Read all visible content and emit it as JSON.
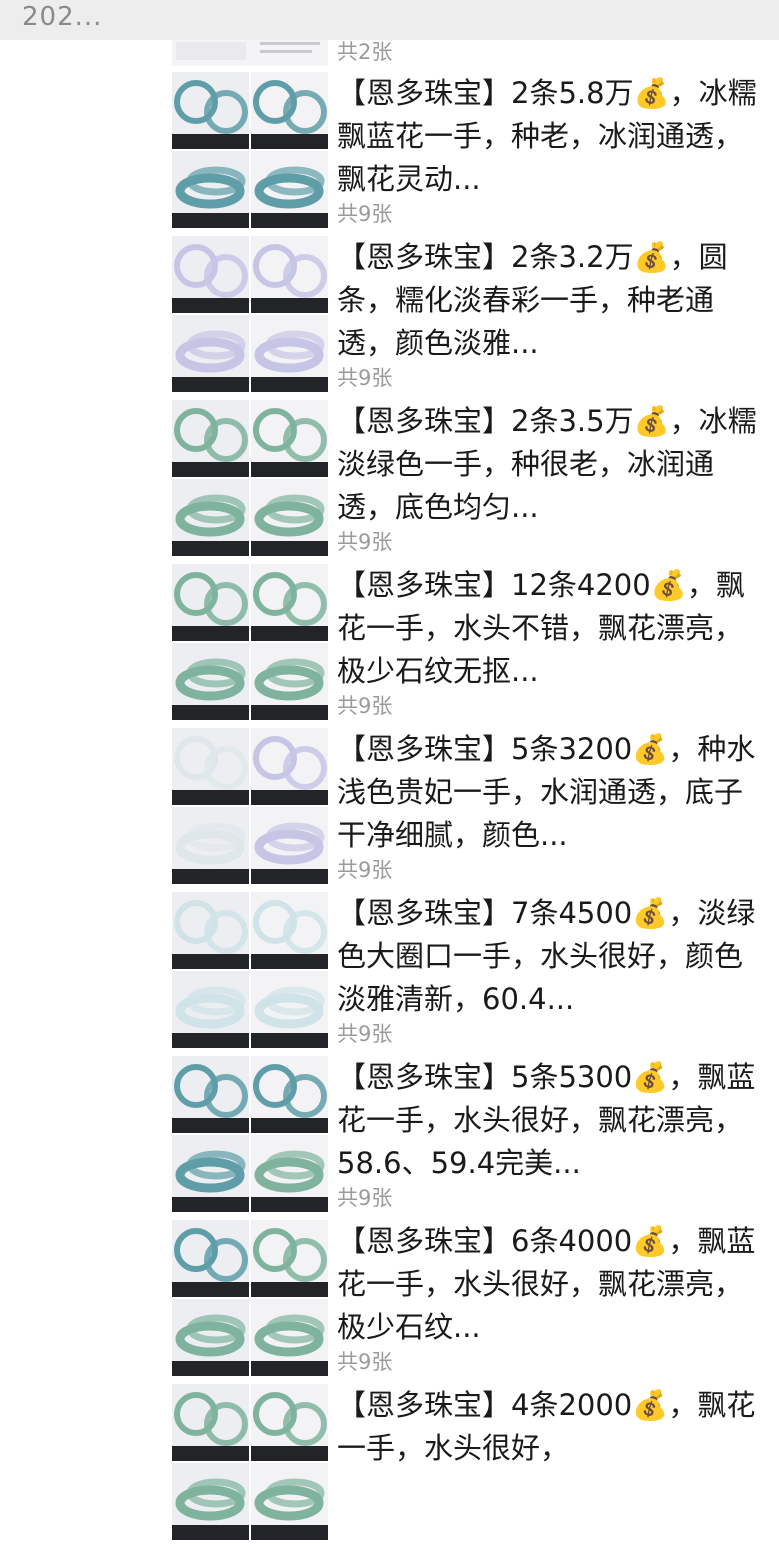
{
  "header": {
    "date": "202..."
  },
  "colors": {
    "jade_blue": "#5f9ea8",
    "jade_green": "#7fb39e",
    "lavender": "#c7c5e6",
    "white_jade": "#dfe7ea",
    "ice": "#cfe3e8"
  },
  "first_post": {
    "count": "共2张"
  },
  "posts": [
    {
      "caption": "【恩多珠宝】2条5.8万💰，冰糯飘蓝花一手，种老，冰润通透，飘花灵动...",
      "count": "共9张",
      "style": [
        "jade_blue",
        "jade_blue",
        "jade_blue",
        "jade_blue"
      ]
    },
    {
      "caption": "【恩多珠宝】2条3.2万💰，圆条，糯化淡春彩一手，种老通透，颜色淡雅...",
      "count": "共9张",
      "style": [
        "lavender",
        "lavender",
        "lavender",
        "lavender"
      ]
    },
    {
      "caption": "【恩多珠宝】2条3.5万💰，冰糯淡绿色一手，种很老，冰润通透，底色均匀...",
      "count": "共9张",
      "style": [
        "jade_green",
        "jade_green",
        "jade_green",
        "jade_green"
      ]
    },
    {
      "caption": "【恩多珠宝】12条4200💰，飘花一手，水头不错，飘花漂亮，极少石纹无抠...",
      "count": "共9张",
      "style": [
        "jade_green",
        "jade_green",
        "jade_green",
        "jade_green"
      ]
    },
    {
      "caption": "【恩多珠宝】5条3200💰，种水浅色贵妃一手，水润通透，底子干净细腻，颜色...",
      "count": "共9张",
      "style": [
        "white_jade",
        "lavender",
        "white_jade",
        "lavender"
      ]
    },
    {
      "caption": "【恩多珠宝】7条4500💰，淡绿色大圈口一手，水头很好，颜色淡雅清新，60.4...",
      "count": "共9张",
      "style": [
        "ice",
        "ice",
        "ice",
        "ice"
      ]
    },
    {
      "caption": "【恩多珠宝】5条5300💰，飘蓝花一手，水头很好，飘花漂亮，58.6、59.4完美...",
      "count": "共9张",
      "style": [
        "jade_blue",
        "jade_blue",
        "jade_blue",
        "jade_green"
      ]
    },
    {
      "caption": "【恩多珠宝】6条4000💰，飘蓝花一手，水头很好，飘花漂亮，极少石纹...",
      "count": "共9张",
      "style": [
        "jade_blue",
        "jade_green",
        "jade_green",
        "jade_green"
      ]
    },
    {
      "caption": "【恩多珠宝】4条2000💰，飘花一手，水头很好，",
      "count": "",
      "style": [
        "jade_green",
        "jade_green",
        "jade_green",
        "jade_green"
      ]
    }
  ]
}
